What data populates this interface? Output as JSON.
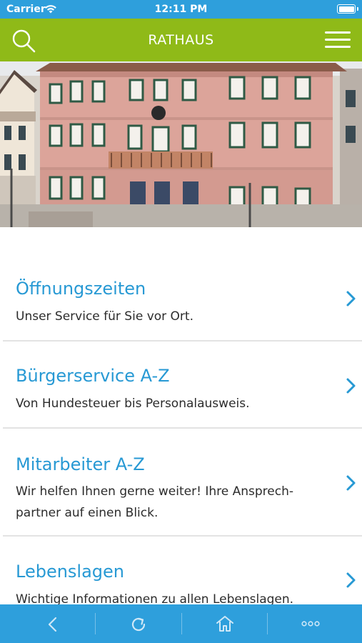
{
  "status_bar": {
    "carrier": "Carrier",
    "time": "12:11 PM"
  },
  "header": {
    "title": "RATHAUS",
    "icons": [
      "search-icon",
      "hamburger-menu-icon"
    ]
  },
  "hero": {
    "description": "Foto des Rathauses"
  },
  "items": [
    {
      "title": "Öffnungszeiten",
      "desc_lines": [
        "Unser Service für Sie vor Ort."
      ]
    },
    {
      "title": "Bürgerservice A-Z",
      "desc_lines": [
        "Von Hundesteuer bis Personalausweis."
      ]
    },
    {
      "title": "Mitarbeiter A-Z",
      "desc_lines": [
        "Wir helfen Ihnen gerne weiter! Ihre Ansprech-",
        "partner auf einen Blick."
      ]
    },
    {
      "title": "Lebenslagen",
      "desc_lines": [
        "Wichtige Informationen zu allen Lebenslagen."
      ]
    }
  ],
  "toolbar": {
    "icons": [
      "back-icon",
      "refresh-icon",
      "home-icon",
      "more-icon"
    ]
  },
  "colors": {
    "header": "#8fba18",
    "status_bar": "#2e9fdc",
    "toolbar": "#2e9fdc",
    "link": "#2799d4"
  }
}
